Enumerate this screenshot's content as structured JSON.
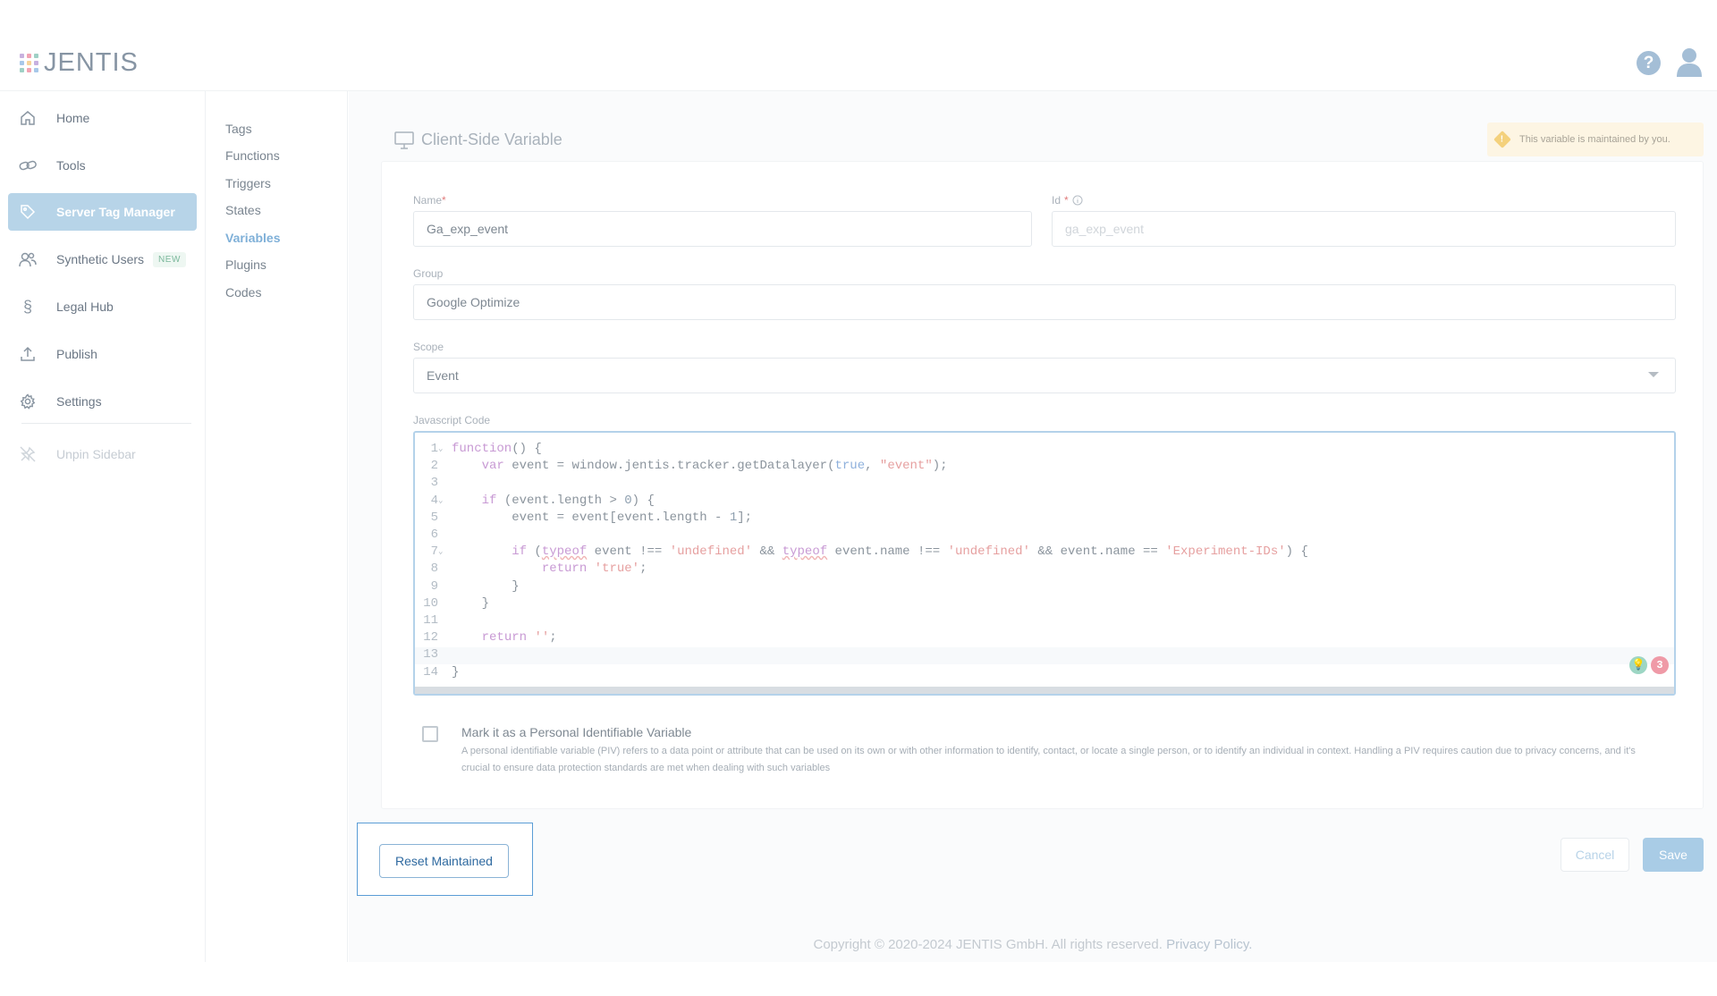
{
  "brand": {
    "name": "JENTIS",
    "dot_colors": [
      "#c8b1de",
      "#f2a3b3",
      "#9fd0c5",
      "#a8c8e9",
      "#f7d49b",
      "#c7b0e0",
      "#9fd0c5",
      "#f2a3b3",
      "#a8c8e9"
    ]
  },
  "header": {
    "help_icon": "?",
    "user_icon": "user-icon"
  },
  "sidebar": {
    "items": [
      {
        "label": "Home",
        "icon": "home-icon"
      },
      {
        "label": "Tools",
        "icon": "link-icon"
      },
      {
        "label": "Server Tag Manager",
        "icon": "tag-icon",
        "active": true
      },
      {
        "label": "Synthetic Users",
        "icon": "users-icon",
        "badge": "NEW"
      },
      {
        "label": "Legal Hub",
        "icon": "section-icon"
      },
      {
        "label": "Publish",
        "icon": "upload-icon"
      },
      {
        "label": "Settings",
        "icon": "gear-icon"
      }
    ],
    "unpin_label": "Unpin Sidebar",
    "active_color": "#b7d4e8"
  },
  "subnav": {
    "items": [
      "Tags",
      "Functions",
      "Triggers",
      "States",
      "Variables",
      "Plugins",
      "Codes"
    ],
    "active": "Variables"
  },
  "panel": {
    "title": "Client-Side Variable",
    "maintained_note": "This variable is maintained by you."
  },
  "form": {
    "name_label": "Name",
    "name_value": "Ga_exp_event",
    "id_label": "Id",
    "id_placeholder": "ga_exp_event",
    "group_label": "Group",
    "group_value": "Google Optimize",
    "scope_label": "Scope",
    "scope_value": "Event",
    "code_label": "Javascript Code",
    "required_mark": "*"
  },
  "code": {
    "lines": [
      "function() {",
      "    var event = window.jentis.tracker.getDatalayer(true, \"event\");",
      "",
      "    if (event.length > 0) {",
      "        event = event[event.length - 1];",
      "",
      "        if (typeof event !== 'undefined' && typeof event.name !== 'undefined' && event.name == 'Experiment-IDs') {",
      "            return 'true';",
      "        }",
      "    }",
      "",
      "    return '';",
      "  ",
      "}"
    ],
    "fold_lines": [
      1,
      4,
      7
    ],
    "error_count": "3"
  },
  "piv": {
    "title": "Mark it as a Personal Identifiable Variable",
    "description": "A personal identifiable variable (PIV) refers to a data point or attribute that can be used on its own or with other information to identify, contact, or locate a single person, or to identify an individual in context. Handling a PIV requires caution due to privacy concerns, and it's crucial to ensure data protection standards are met when dealing with such variables"
  },
  "buttons": {
    "reset": "Reset Maintained",
    "cancel": "Cancel",
    "save": "Save"
  },
  "footer": {
    "copyright": "Copyright © 2020-2024 JENTIS GmbH. All rights reserved.",
    "privacy": "Privacy Policy."
  }
}
